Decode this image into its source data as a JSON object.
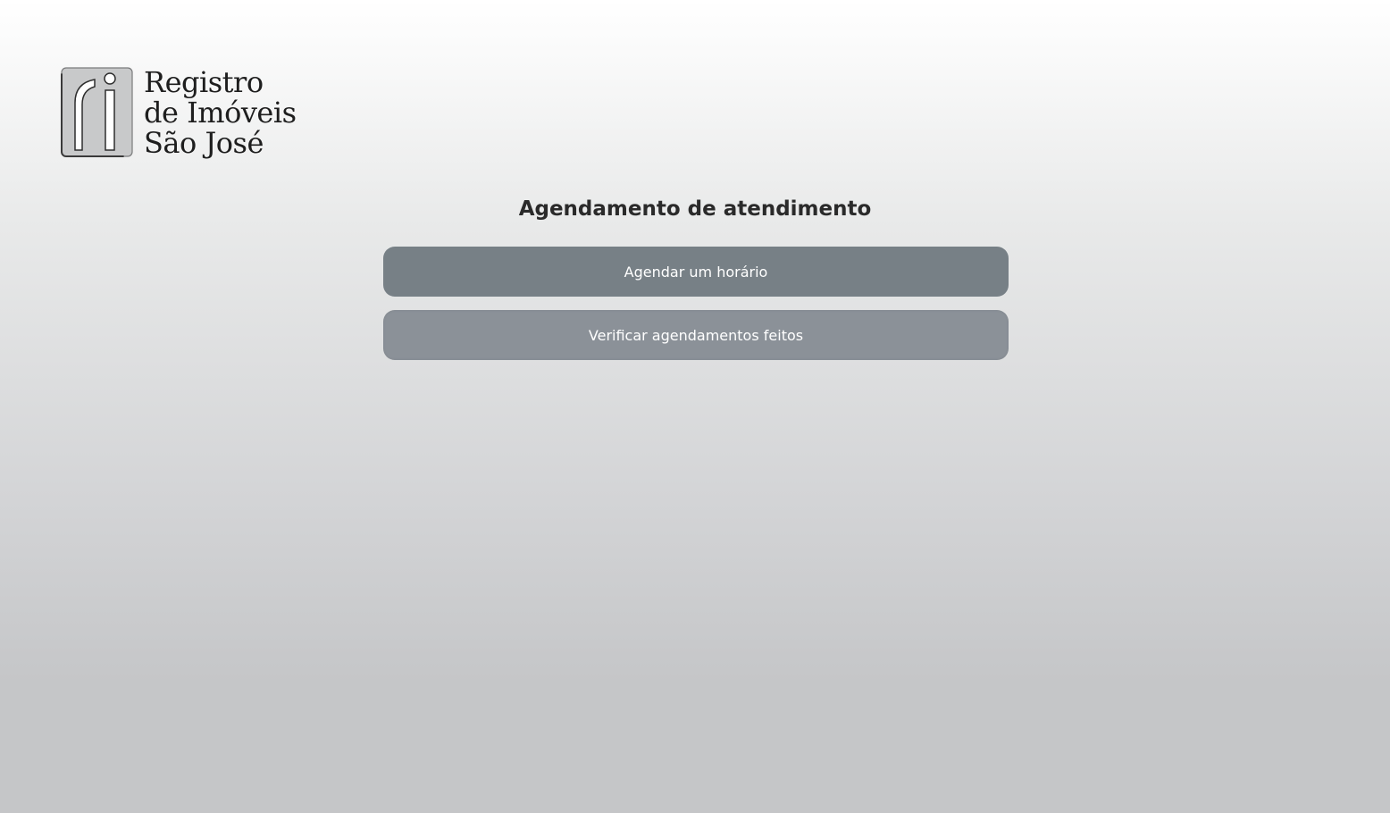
{
  "logo": {
    "line1": "Registro",
    "line2": "de Imóveis",
    "line3": "São José",
    "icon": "ri-monogram-icon"
  },
  "page": {
    "title": "Agendamento de atendimento"
  },
  "actions": {
    "schedule_label": "Agendar um horário",
    "check_label": "Verificar agendamentos feitos"
  },
  "colors": {
    "primary_button": "#778086",
    "secondary_button": "#8b9198",
    "title_text": "#2a2a2a"
  }
}
